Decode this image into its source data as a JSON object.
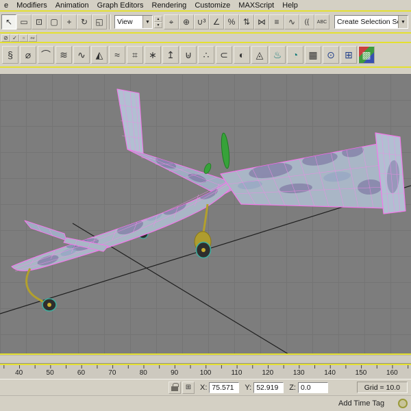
{
  "menu_bar": {
    "items": [
      "e",
      "Modifiers",
      "Animation",
      "Graph Editors",
      "Rendering",
      "Customize",
      "MAXScript",
      "Help"
    ]
  },
  "toolbar_main": {
    "icons_left": [
      {
        "name": "select-object-icon",
        "glyph": "↖",
        "pressed": true
      },
      {
        "name": "rect-selection-region-icon",
        "glyph": "▭"
      },
      {
        "name": "window-crossing-icon",
        "glyph": "⊡"
      },
      {
        "name": "selection-filter-icon",
        "glyph": "▢"
      },
      {
        "name": "select-and-move-icon",
        "glyph": "+"
      },
      {
        "name": "select-and-rotate-icon",
        "glyph": "↻"
      },
      {
        "name": "select-and-scale-icon",
        "glyph": "◱"
      }
    ],
    "view_dropdown": {
      "value": "View"
    },
    "icons_mid": [
      {
        "name": "use-pivot-point-icon",
        "glyph": "⌖"
      },
      {
        "name": "select-and-manipulate-icon",
        "glyph": "⊕"
      },
      {
        "name": "snap-toggle-icon",
        "glyph": "∪³"
      },
      {
        "name": "angle-snap-icon",
        "glyph": "∠"
      },
      {
        "name": "percent-snap-icon",
        "glyph": "%"
      },
      {
        "name": "spinner-snap-icon",
        "glyph": "⇅"
      },
      {
        "name": "mirror-icon",
        "glyph": "⋈"
      },
      {
        "name": "align-icon",
        "glyph": "≡"
      },
      {
        "name": "curve-editor-icon",
        "glyph": "∿"
      },
      {
        "name": "schematic-view-icon",
        "glyph": "({"
      },
      {
        "name": "rename-objects-icon",
        "glyph": "ABC"
      }
    ],
    "selection_set_combo": {
      "value": "Create Selection Set"
    }
  },
  "toolbar_mini": {
    "icons": [
      {
        "name": "mini-tool-icon-1",
        "glyph": "⊘"
      },
      {
        "name": "mini-tool-icon-2",
        "glyph": "✓"
      },
      {
        "name": "mini-tool-icon-3",
        "glyph": "▫"
      },
      {
        "name": "mini-tool-icon-4",
        "glyph": "∾"
      }
    ]
  },
  "toolbar_secondary": {
    "icons": [
      {
        "name": "helix-tool-icon",
        "glyph": "§"
      },
      {
        "name": "lathe-tool-icon",
        "glyph": "⌀"
      },
      {
        "name": "bend-tool-icon",
        "glyph": "⌒"
      },
      {
        "name": "wave-tool-icon",
        "glyph": "≋"
      },
      {
        "name": "ripple-tool-icon",
        "glyph": "∿"
      },
      {
        "name": "taper-tool-icon",
        "glyph": "◭"
      },
      {
        "name": "noise-tool-icon",
        "glyph": "≈"
      },
      {
        "name": "lattice-tool-icon",
        "glyph": "⌗"
      },
      {
        "name": "smooth-tool-icon",
        "glyph": "∗"
      },
      {
        "name": "extrude-tool-icon",
        "glyph": "↥"
      },
      {
        "name": "boolean-tool-icon",
        "glyph": "⊎"
      },
      {
        "name": "scatter-tool-icon",
        "glyph": "∴"
      },
      {
        "name": "conform-tool-icon",
        "glyph": "⊂"
      },
      {
        "name": "morph-tool-icon",
        "glyph": "◐"
      },
      {
        "name": "mesher-tool-icon",
        "glyph": "◬"
      },
      {
        "name": "render-scene-icon",
        "glyph": "♨",
        "tone": "teal"
      },
      {
        "name": "quick-render-icon",
        "glyph": "◔",
        "tone": "teal"
      },
      {
        "name": "layer-manager-icon",
        "glyph": "▦"
      },
      {
        "name": "zoom-tool-icon",
        "glyph": "⊙",
        "tone": "blue"
      },
      {
        "name": "region-zoom-icon",
        "glyph": "⊞",
        "tone": "blue"
      },
      {
        "name": "color-swatch-icon",
        "glyph": "▩"
      }
    ]
  },
  "timeline": {
    "labels": [
      "40",
      "50",
      "60",
      "70",
      "80",
      "90",
      "100",
      "110",
      "120",
      "130",
      "140",
      "150",
      "160"
    ]
  },
  "status_bar": {
    "x_label": "X:",
    "x_value": "75.571",
    "y_label": "Y:",
    "y_value": "52.919",
    "z_label": "Z:",
    "z_value": "0.0",
    "grid_text": "Grid = 10.0",
    "add_time_tag": "Add Time Tag"
  },
  "ui_glyphs": {
    "dropdown_arrow": "▼",
    "spinner_up": "▲",
    "spinner_down": "▼",
    "typein_toggle": "⊞"
  },
  "colors": {
    "accent_yellow": "#e4e030",
    "toolbar_bg": "#d4d0c4",
    "viewport_bg": "#7d7d7d",
    "wireframe_pink": "#f279ea",
    "surface_blue": "#a9b6c6",
    "camo_purple": "#6e6096",
    "gear_yellow": "#ae9c2f",
    "prop_green": "#37a23a",
    "wheel_rim_teal": "#3fae9f"
  }
}
